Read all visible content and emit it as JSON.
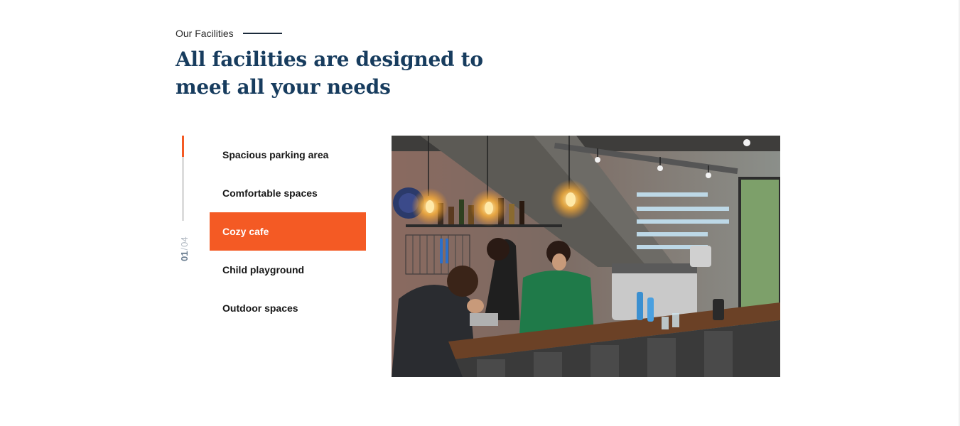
{
  "section": {
    "eyebrow": "Our Facilities",
    "title": "All facilities are designed to meet all your needs"
  },
  "slider": {
    "current": "01",
    "separator": "/",
    "total": "04",
    "progress_fraction": 0.25
  },
  "facilities": [
    {
      "label": "Spacious parking area",
      "active": false
    },
    {
      "label": "Comfortable spaces",
      "active": false
    },
    {
      "label": "Cozy cafe",
      "active": true
    },
    {
      "label": "Child playground",
      "active": false
    },
    {
      "label": "Outdoor spaces",
      "active": false
    }
  ],
  "photo": {
    "subject": "cafe interior with baristas behind a wooden counter"
  },
  "colors": {
    "accent": "#f45a24",
    "heading": "#173c5e",
    "track": "#dcdcdc"
  }
}
